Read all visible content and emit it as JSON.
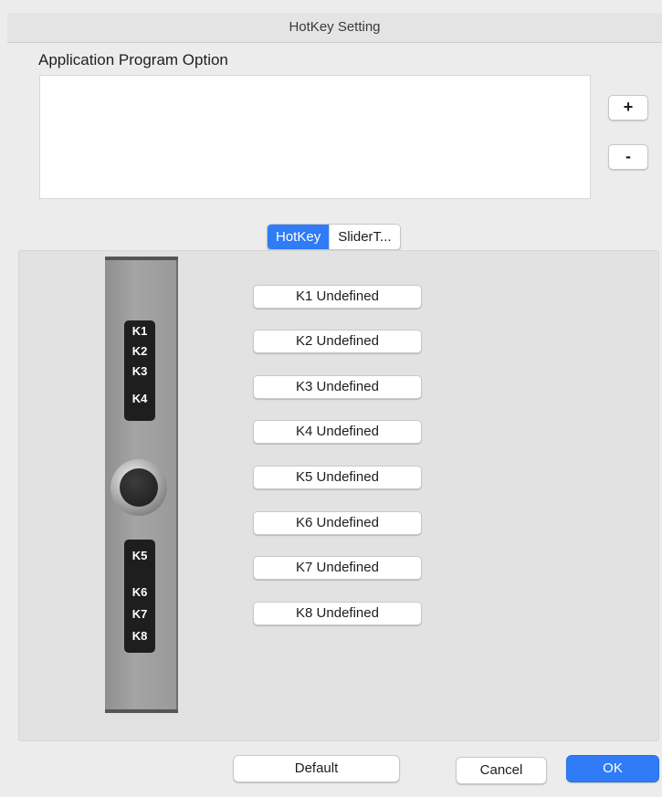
{
  "window": {
    "title": "HotKey Setting"
  },
  "app_option": {
    "label": "Application Program Option",
    "add_label": "+",
    "remove_label": "-"
  },
  "tabs": [
    {
      "label": "HotKey",
      "active": true
    },
    {
      "label": "SliderT...",
      "active": false
    }
  ],
  "device": {
    "top_keys": [
      "K1",
      "K2",
      "K3",
      "K4"
    ],
    "bottom_keys": [
      "K5",
      "K6",
      "K7",
      "K8"
    ]
  },
  "hotkeys": [
    "K1 Undefined",
    "K2 Undefined",
    "K3 Undefined",
    "K4 Undefined",
    "K5 Undefined",
    "K6 Undefined",
    "K7 Undefined",
    "K8 Undefined"
  ],
  "footer": {
    "default_label": "Default",
    "cancel_label": "Cancel",
    "ok_label": "OK"
  },
  "colors": {
    "accent": "#2f7cf6",
    "key_bg": "#1e1e1e"
  }
}
